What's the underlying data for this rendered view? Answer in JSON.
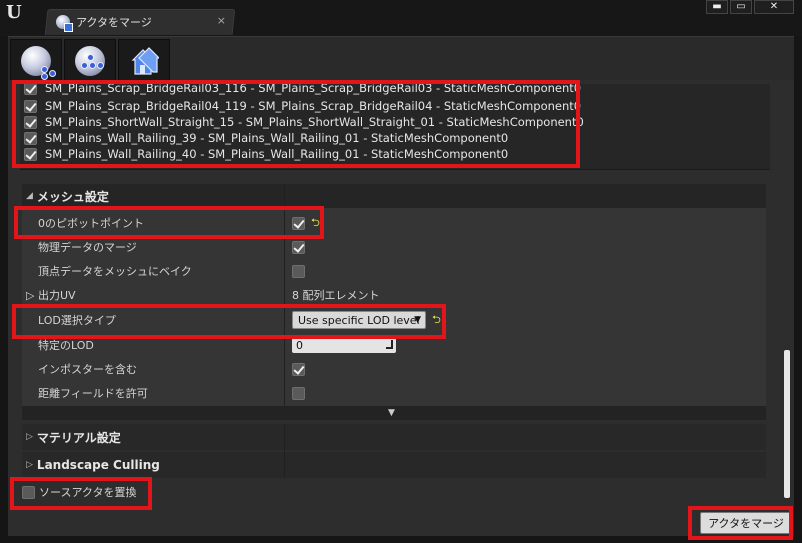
{
  "window": {
    "tab_title": "アクタをマージ",
    "tab_close": "×",
    "minimize": "▬",
    "maximize": "▭",
    "close": "✕"
  },
  "toolbar": {
    "buttons": [
      {
        "icon": "merge-actors-icon"
      },
      {
        "icon": "proxy-mesh-icon"
      },
      {
        "icon": "instancing-icon"
      }
    ]
  },
  "actors": [
    {
      "label": "SM_Plains_Scrap_BridgeRail03_116 - SM_Plains_Scrap_BridgeRail03 - StaticMeshComponent0",
      "checked": true
    },
    {
      "label": "SM_Plains_Scrap_BridgeRail04_119 - SM_Plains_Scrap_BridgeRail04 - StaticMeshComponent0",
      "checked": true
    },
    {
      "label": "SM_Plains_ShortWall_Straight_15 - SM_Plains_ShortWall_Straight_01 - StaticMeshComponent0",
      "checked": true
    },
    {
      "label": "SM_Plains_Wall_Railing_39 - SM_Plains_Wall_Railing_01 - StaticMeshComponent0",
      "checked": true
    },
    {
      "label": "SM_Plains_Wall_Railing_40 - SM_Plains_Wall_Railing_01 - StaticMeshComponent0",
      "checked": true
    }
  ],
  "mesh_settings": {
    "title": "メッシュ設定",
    "pivot_zero": {
      "label": "0のピボットポイント",
      "checked": true
    },
    "merge_physics": {
      "label": "物理データのマージ",
      "checked": true
    },
    "bake_vertex": {
      "label": "頂点データをメッシュにベイク",
      "checked": false
    },
    "output_uv": {
      "label": "出力UV",
      "value": "8 配列エレメント"
    },
    "lod_type": {
      "label": "LOD選択タイプ",
      "value": "Use specific LOD level"
    },
    "specific_lod": {
      "label": "特定のLOD",
      "value": "0"
    },
    "include_imposters": {
      "label": "インポスターを含む",
      "checked": true
    },
    "allow_distance_field": {
      "label": "距離フィールドを許可",
      "checked": false
    }
  },
  "material_settings": {
    "title": "マテリアル設定"
  },
  "landscape_culling": {
    "title": "Landscape Culling"
  },
  "replace_source": {
    "label": "ソースアクタを置換",
    "checked": false
  },
  "merge_button": "アクタをマージ",
  "reset_glyph": "⮌",
  "colors": {
    "highlight": "#e1151a",
    "panel": "#2d2d2d",
    "reset_arrow": "#e8e246"
  }
}
